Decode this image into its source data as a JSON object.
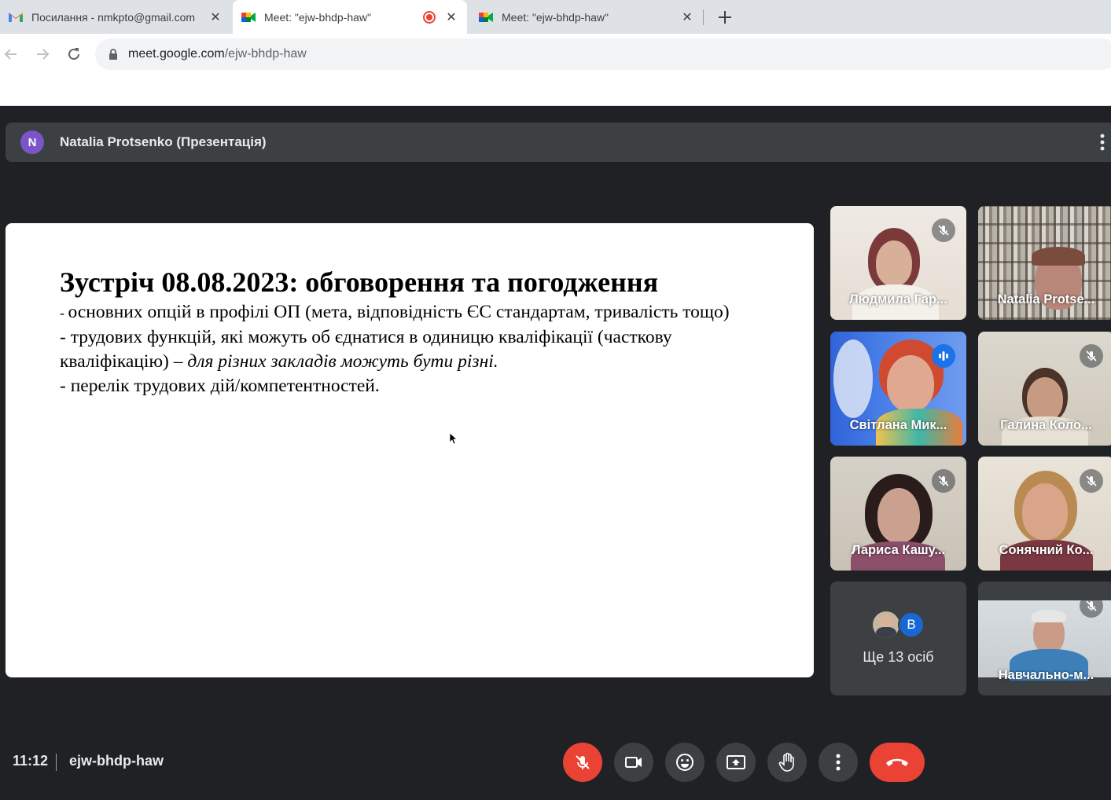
{
  "browser": {
    "tabs": [
      {
        "title": "Посилання - nmkpto@gmail.com",
        "icon": "gmail-icon"
      },
      {
        "title": "Meet: \"ejw-bhdp-haw\"",
        "icon": "meet-icon",
        "recording": true
      },
      {
        "title": "Meet: \"ejw-bhdp-haw\"",
        "icon": "meet-icon"
      }
    ],
    "url_host": "meet.google.com",
    "url_path": "/ejw-bhdp-haw"
  },
  "meet": {
    "presenter": {
      "initial": "N",
      "label": "Natalia Protsenko (Презентація)"
    },
    "slide": {
      "title": "Зустріч 08.08.2023: обговорення та погодження",
      "line1_dash": "- ",
      "line1": "основних опцій в профілі ОП (мета, відповідність ЄС стандартам, тривалість тощо)",
      "line2": "- трудових функцій, які можуть об єднатися в одиницю кваліфікації (часткову кваліфікацію) –",
      "line2_italic": " для різних закладів можуть бути різні.",
      "line3": "- перелік трудових дій/компетентностей."
    },
    "participants": [
      {
        "name": "Людмила Гар...",
        "muted": true
      },
      {
        "name": "Natalia Protse...",
        "muted": false
      },
      {
        "name": "Світлана Мик...",
        "speaking": true
      },
      {
        "name": "Галина Коло...",
        "muted": true
      },
      {
        "name": "Лариса Кашу...",
        "muted": true
      },
      {
        "name": "Сонячний Ко...",
        "muted": true
      },
      {
        "name": "Навчально-м...",
        "muted": true
      }
    ],
    "more": {
      "avatar_letter": "B",
      "label": "Ще 13 осіб"
    },
    "bottom": {
      "time": "11:12",
      "meeting_code": "ejw-bhdp-haw"
    },
    "colors": {
      "background": "#202124",
      "tile": "#3c4043",
      "danger": "#ea4335",
      "speaker_accent": "#1a73e8"
    }
  }
}
